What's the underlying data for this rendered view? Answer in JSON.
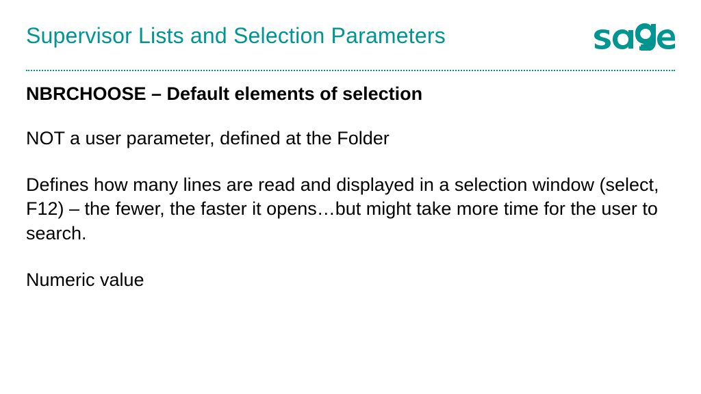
{
  "header": {
    "title": "Supervisor Lists and Selection Parameters",
    "logo_name": "sage"
  },
  "content": {
    "heading": "NBRCHOOSE – Default elements of selection",
    "para1": "NOT a user parameter, defined at the Folder",
    "para2": "Defines how many lines are read and displayed in a selection window (select, F12) – the fewer, the faster it opens…but might take more time for the user to search.",
    "para3": "Numeric value"
  },
  "colors": {
    "brand": "#009590"
  }
}
